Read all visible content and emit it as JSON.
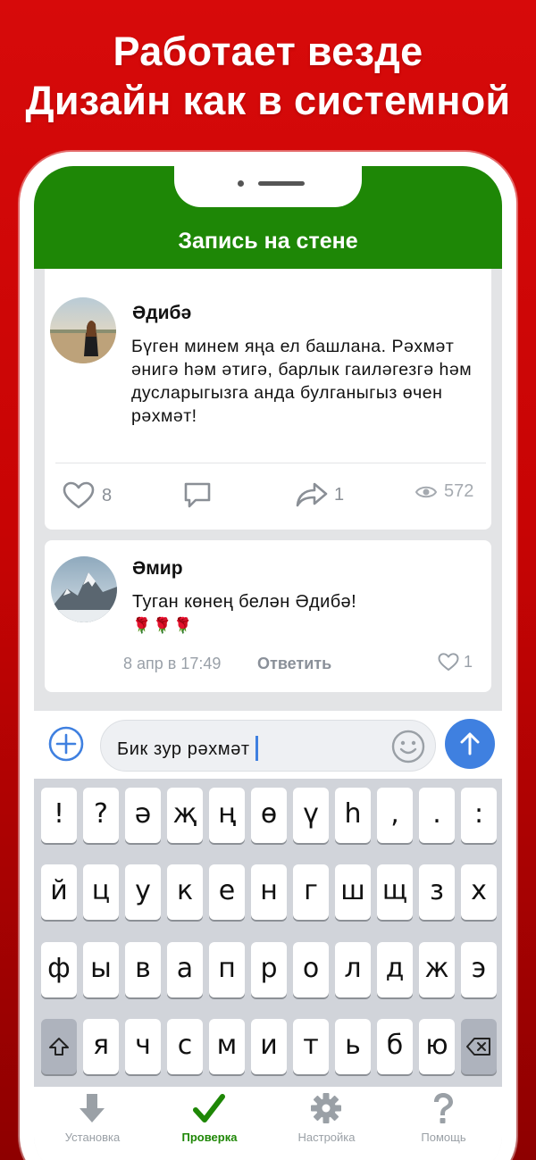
{
  "promo": {
    "line1": "Работает везде",
    "line2": "Дизайн как в системной"
  },
  "header": {
    "title": "Запись на стене",
    "color": "#1e8706"
  },
  "post": {
    "author": "Әдибә",
    "text": "Бүген минем яңа ел башлана. Рәхмәт әнигә һәм әтигә, барлык гаиләгезгә һәм дусларыгызга анда булганыгыз өчен рәхмәт!",
    "likes": "8",
    "shares": "1",
    "views": "572"
  },
  "comment": {
    "author": "Әмир",
    "text": "Туган көнең белән Әдибә!",
    "emoji": "🌹🌹🌹",
    "time": "8 апр в 17:49",
    "reply_label": "Ответить",
    "likes": "1"
  },
  "composer": {
    "value": "Бик зур рәхмәт",
    "accent": "#3f80e0"
  },
  "keyboard": {
    "row1": [
      "!",
      "?",
      "ә",
      "җ",
      "ң",
      "ө",
      "ү",
      "һ",
      ",",
      ".",
      ":"
    ],
    "row2": [
      "й",
      "ц",
      "у",
      "к",
      "е",
      "н",
      "г",
      "ш",
      "щ",
      "з",
      "х"
    ],
    "row3": [
      "ф",
      "ы",
      "в",
      "а",
      "п",
      "р",
      "о",
      "л",
      "д",
      "ж",
      "э"
    ],
    "row4": [
      "я",
      "ч",
      "с",
      "м",
      "и",
      "т",
      "ь",
      "б",
      "ю"
    ],
    "shift_icon": "shift-icon",
    "backspace_icon": "backspace-icon"
  },
  "tabs": [
    {
      "label": "Установка",
      "icon": "download-arrow-icon"
    },
    {
      "label": "Проверка",
      "icon": "checkmark-icon"
    },
    {
      "label": "Настройка",
      "icon": "gear-icon"
    },
    {
      "label": "Помощь",
      "icon": "question-icon"
    }
  ]
}
